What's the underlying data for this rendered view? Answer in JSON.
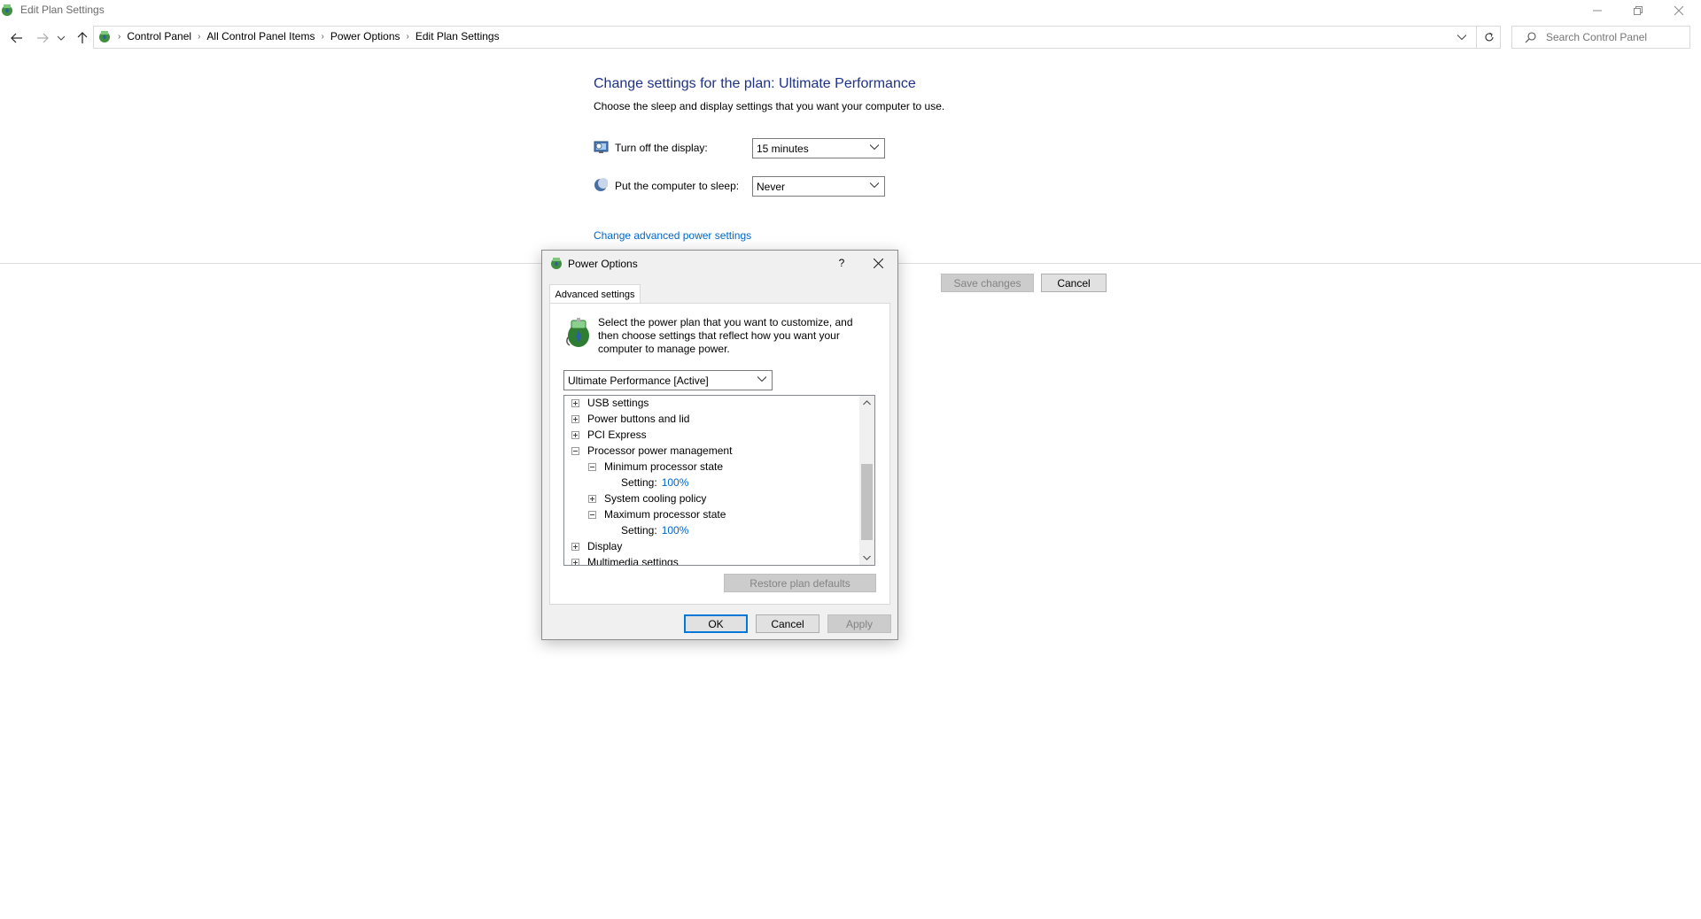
{
  "window": {
    "title": "Edit Plan Settings",
    "icon": "power-options-icon"
  },
  "caption_buttons": [
    "minimize-icon",
    "restore-icon",
    "close-icon"
  ],
  "nav": {
    "back_icon": "back-arrow-icon",
    "forward_icon": "forward-arrow-icon",
    "recent_icon": "chevron-down-icon",
    "up_icon": "up-arrow-icon"
  },
  "breadcrumb": {
    "icon": "control-panel-icon",
    "items": [
      "Control Panel",
      "All Control Panel Items",
      "Power Options",
      "Edit Plan Settings"
    ]
  },
  "search": {
    "placeholder": "Search Control Panel"
  },
  "main": {
    "title": "Change settings for the plan: Ultimate Performance",
    "subtitle": "Choose the sleep and display settings that you want your computer to use.",
    "display_label": "Turn off the display:",
    "display_value": "15 minutes",
    "sleep_label": "Put the computer to sleep:",
    "sleep_value": "Never",
    "advanced_link": "Change advanced power settings",
    "save_label": "Save changes",
    "cancel_label": "Cancel"
  },
  "dialog": {
    "title": "Power Options",
    "help_label": "?",
    "tab_label": "Advanced settings",
    "instruction": "Select the power plan that you want to customize, and then choose settings that reflect how you want your computer to manage power.",
    "plan_value": "Ultimate Performance [Active]",
    "tree": [
      {
        "label": "USB settings",
        "state": "collapsed",
        "level": 0
      },
      {
        "label": "Power buttons and lid",
        "state": "collapsed",
        "level": 0
      },
      {
        "label": "PCI Express",
        "state": "collapsed",
        "level": 0
      },
      {
        "label": "Processor power management",
        "state": "expanded",
        "level": 0
      },
      {
        "label": "Minimum processor state",
        "state": "expanded",
        "level": 1
      },
      {
        "label": "Setting:",
        "value": "100%",
        "level": 2
      },
      {
        "label": "System cooling policy",
        "state": "collapsed",
        "level": 1
      },
      {
        "label": "Maximum processor state",
        "state": "expanded",
        "level": 1
      },
      {
        "label": "Setting:",
        "value": "100%",
        "level": 2
      },
      {
        "label": "Display",
        "state": "collapsed",
        "level": 0
      },
      {
        "label": "Multimedia settings",
        "state": "collapsed",
        "level": 0
      }
    ],
    "restore_label": "Restore plan defaults",
    "ok_label": "OK",
    "cancel_label": "Cancel",
    "apply_label": "Apply"
  }
}
